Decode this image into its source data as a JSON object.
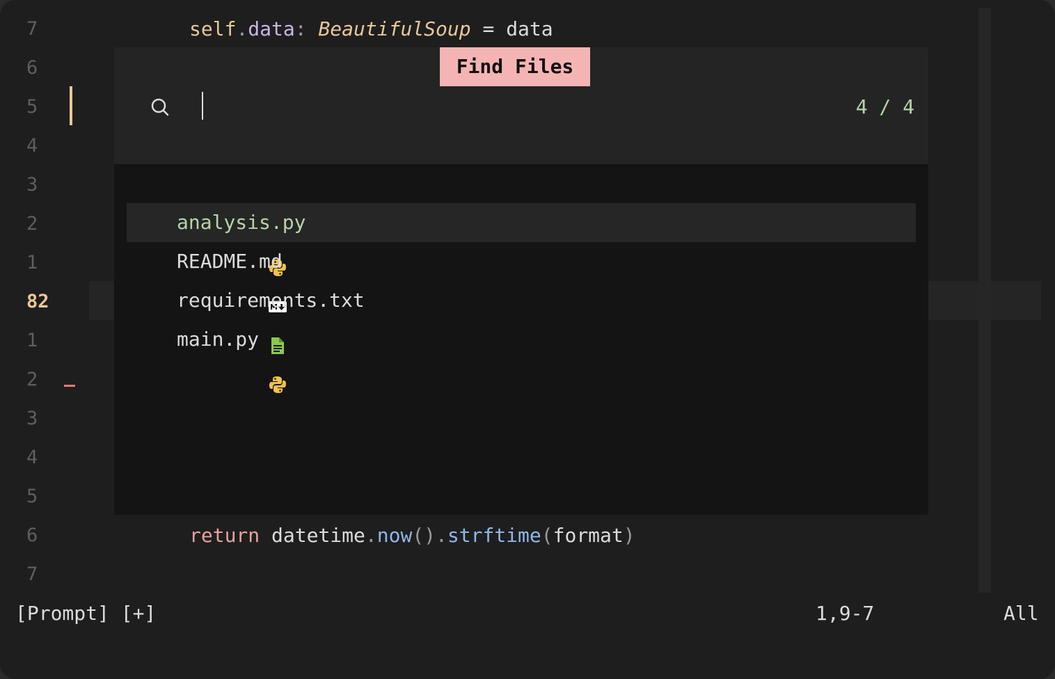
{
  "editor": {
    "gutter": [
      "7",
      "6",
      "5",
      "4",
      "3",
      "2",
      "1",
      "82",
      "1",
      "2",
      "3",
      "4",
      "5",
      "6",
      "7"
    ],
    "current_line_index": 7,
    "top_code": {
      "self": "self",
      "dot": ".",
      "attr": "data",
      "colon": ": ",
      "type": "BeautifulSoup",
      "eq": " = ",
      "value": "data"
    },
    "bottom_code": {
      "kw": "return",
      "obj": " datetime",
      "dot1": ".",
      "fn1": "now",
      "paren1": "()",
      "dot2": ".",
      "fn2": "strftime",
      "paren_open": "(",
      "arg": "format",
      "paren_close": ")"
    }
  },
  "picker": {
    "title": "Find Files",
    "query": "",
    "count": "4 / 4",
    "results": [
      {
        "name": "analysis.py",
        "icon": "python-icon",
        "selected": true
      },
      {
        "name": "README.md",
        "icon": "markdown-icon",
        "selected": false
      },
      {
        "name": "requirements.txt",
        "icon": "text-file-icon",
        "selected": false
      },
      {
        "name": "main.py",
        "icon": "python-icon",
        "selected": false
      }
    ]
  },
  "statusline": {
    "left": "[Prompt] [+]",
    "position": "1,9-7",
    "scroll": "All"
  },
  "colors": {
    "background": "#1e1e1e",
    "accent_badge": "#f4b4b4",
    "match_green": "#b6d4a8",
    "python_yellow": "#f1c14e",
    "text_file_green": "#8cc84b"
  }
}
